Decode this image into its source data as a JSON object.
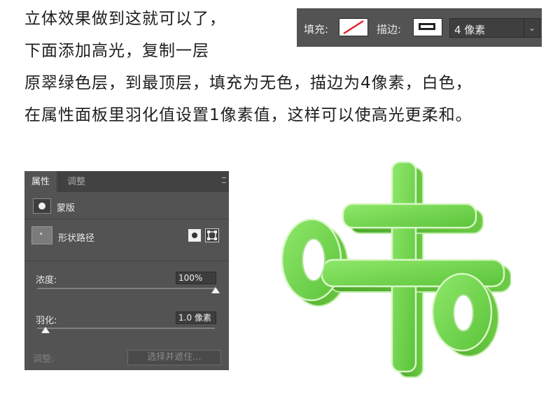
{
  "instructions": {
    "line1": "立体效果做到这就可以了，",
    "line2": "下面添加高光，复制一层",
    "line3": "原翠绿色层，到最顶层，填充为无色，描边为4像素，白色，",
    "line4": "在属性面板里羽化值设置1像素值，这样可以使高光更柔和。"
  },
  "toolbar": {
    "fill_label": "填充:",
    "stroke_label": "描边:",
    "stroke_size": "4 像素",
    "fill_icon": "no-color-swatch-icon",
    "stroke_icon": "stroke-swatch-icon",
    "dropdown_icon": "chevron-down-icon"
  },
  "panel": {
    "tab_properties": "属性",
    "tab_adjust": "调整",
    "mask_label": "蒙版",
    "shape_path_label": "形状路径",
    "density_label": "浓度:",
    "density_value": "100%",
    "density_level": 1.0,
    "feather_label": "羽化:",
    "feather_value": "1.0 像素",
    "feather_level": 0.05,
    "adjust_label": "调整:",
    "select_mask_button": "选择并遮住..."
  },
  "colors": {
    "panel_bg": "#535353",
    "accent_green": "#6fcf3f",
    "toolbar_bg": "#535353"
  }
}
